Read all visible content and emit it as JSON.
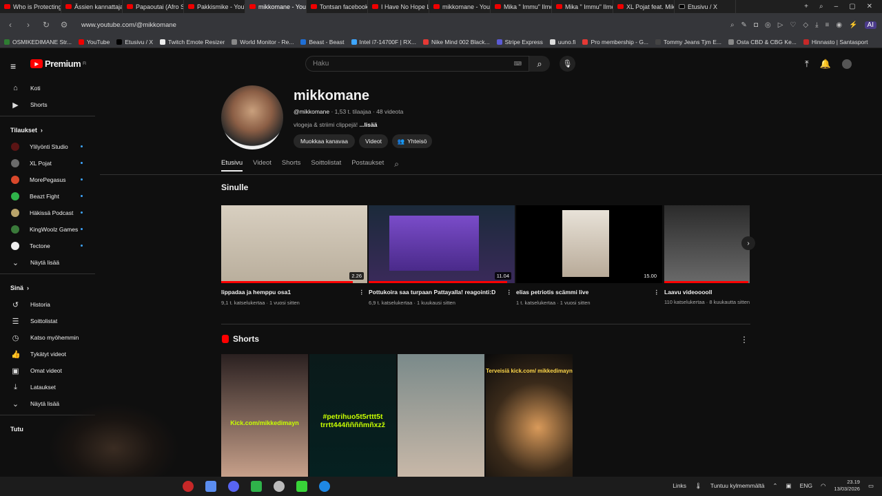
{
  "browser": {
    "tabs": [
      {
        "label": "Who is Protecting th",
        "active": false
      },
      {
        "label": "Ässien kannattajat",
        "active": false
      },
      {
        "label": "Papaoutai (Afro Sou",
        "active": false
      },
      {
        "label": "Pakkismike - YouTu",
        "active": false
      },
      {
        "label": "mikkomane - YouTube",
        "active": true
      },
      {
        "label": "Tontsan facebookki",
        "active": false
      },
      {
        "label": "I Have No Hope Lef",
        "active": false
      },
      {
        "label": "mikkomane - YouTu",
        "active": false
      },
      {
        "label": "Mika \" Immu\" Ilmé",
        "active": false
      },
      {
        "label": "Mika \" Immu\" Ilmé",
        "active": false
      },
      {
        "label": "XL Pojat feat. Mikk",
        "active": false
      },
      {
        "label": "Etusivu / X",
        "active": false
      }
    ],
    "url": "www.youtube.com/@mikkomane",
    "ai_label": "AI",
    "bookmarks": [
      "OSMIKEDIMANE Str...",
      "YouTube",
      "Etusivu / X",
      "Twitch Emote Resizer",
      "World Monitor - Re...",
      "Beast - Beast",
      "Intel i7-14700F | RX...",
      "Nike Mind 002 Black...",
      "Stripe Express",
      "uuno.fi",
      "Pro membership - G...",
      "Tommy Jeans Tjm E...",
      "Osta CBD & CBG Ke...",
      "Hinnasto | Santasport"
    ]
  },
  "header": {
    "logo": "Premium",
    "logo_sup": "FI",
    "search_placeholder": "Haku"
  },
  "sidebar": {
    "main": [
      {
        "label": "Koti",
        "icon": "home-icon"
      },
      {
        "label": "Shorts",
        "icon": "shorts-icon"
      }
    ],
    "subs_title": "Tilaukset",
    "subs": [
      {
        "label": "Ylilyönti Studio",
        "color": "#5a1414"
      },
      {
        "label": "XL Pojat",
        "color": "#6b6b6b"
      },
      {
        "label": "MorePegasus",
        "color": "#d9482b"
      },
      {
        "label": "Beazt Fight",
        "color": "#2fb34a"
      },
      {
        "label": "Häkissä Podcast",
        "color": "#b8a36a"
      },
      {
        "label": "KingWoolz Games",
        "color": "#3a7a3a"
      },
      {
        "label": "Tectone",
        "color": "#eeeeee"
      }
    ],
    "subs_more": "Näytä lisää",
    "you_title": "Sinä",
    "you": [
      {
        "label": "Historia",
        "icon": "history-icon"
      },
      {
        "label": "Soittolistat",
        "icon": "playlist-icon"
      },
      {
        "label": "Katso myöhemmin",
        "icon": "clock-icon"
      },
      {
        "label": "Tykätyt videot",
        "icon": "thumbs-up-icon"
      },
      {
        "label": "Omat videot",
        "icon": "my-videos-icon"
      },
      {
        "label": "Lataukset",
        "icon": "download-icon"
      }
    ],
    "you_more": "Näytä lisää",
    "explore_title": "Tutu"
  },
  "channel": {
    "name": "mikkomane",
    "handle": "@mikkomane",
    "stats": "· 1,53 t. tilaajaa · 48 videota",
    "description": "vlogeja & striimi clippejä!",
    "desc_more": "...lisää",
    "buttons": [
      "Muokkaa kanavaa",
      "Videot",
      "Yhteisö"
    ],
    "tabs": [
      "Etusivu",
      "Videot",
      "Shorts",
      "Soittolistat",
      "Postaukset"
    ]
  },
  "for_you": {
    "title": "Sinulle",
    "videos": [
      {
        "title": "lippadaa ja hemppu osa1",
        "meta": "9,1 t. katselukertaa · 1 vuosi sitten",
        "duration": "2.26",
        "progress": 0.9
      },
      {
        "title": "Pottukoira saa turpaan Pattayalla! reagointi:D",
        "meta": "6,9 t. katselukertaa · 1 kuukausi sitten",
        "duration": "11.04",
        "progress": 0.95
      },
      {
        "title": "elias petriotis scämmi live",
        "meta": "1 t. katselukertaa · 1 vuosi sitten",
        "duration": "15.00",
        "progress": 0
      },
      {
        "title": "Laavu videooooll",
        "meta": "110 katselukertaa · 8 kuukautta sitten",
        "duration": "",
        "progress": 0.98
      }
    ]
  },
  "shorts": {
    "title": "Shorts",
    "items": [
      {
        "overlay": "Kick.com/mikkedimayn"
      },
      {
        "overlay": "#petrihuo5t5rttt5t trrtt444ññññmñxzž"
      },
      {
        "overlay": ""
      },
      {
        "overlay": "Terveisiä kick.com/ mikkedimayn"
      }
    ]
  },
  "taskbar": {
    "links": "Links",
    "weather": "Tuntuu kylmemmältä",
    "lang": "ENG",
    "time": "23.19",
    "date": "13/03/2026"
  }
}
